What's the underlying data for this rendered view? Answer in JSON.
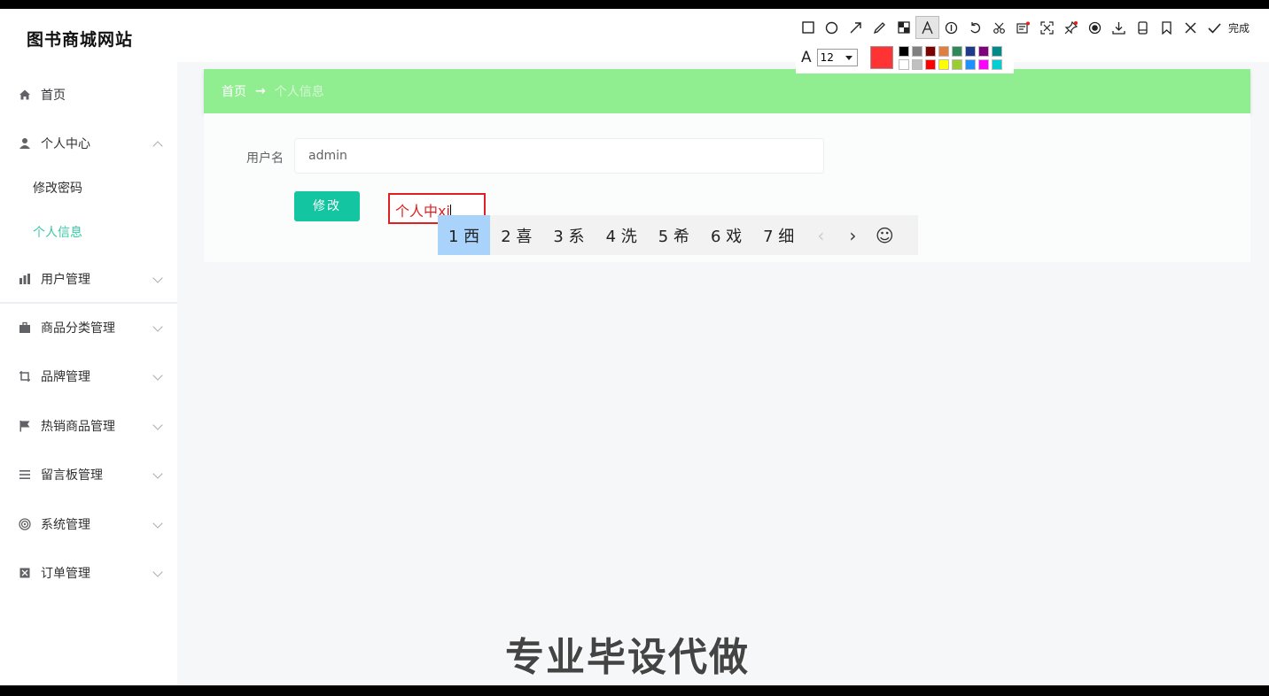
{
  "header": {
    "title": "图书商城网站",
    "links": [
      "",
      "",
      ""
    ]
  },
  "sidebar": {
    "items": [
      {
        "label": "首页",
        "icon": "home-icon"
      },
      {
        "label": "个人中心",
        "icon": "user-icon",
        "expanded": true,
        "children": [
          {
            "label": "修改密码"
          },
          {
            "label": "个人信息",
            "active": true
          }
        ]
      },
      {
        "label": "用户管理",
        "icon": "chart-icon"
      },
      {
        "label": "商品分类管理",
        "icon": "briefcase-icon"
      },
      {
        "label": "品牌管理",
        "icon": "crop-icon"
      },
      {
        "label": "热销商品管理",
        "icon": "flag-icon"
      },
      {
        "label": "留言板管理",
        "icon": "list-icon"
      },
      {
        "label": "系统管理",
        "icon": "target-icon"
      },
      {
        "label": "订单管理",
        "icon": "box-icon"
      }
    ]
  },
  "breadcrumb": {
    "home": "首页",
    "separator": "→",
    "current": "个人信息"
  },
  "form": {
    "username_label": "用户名",
    "username_value": "admin",
    "submit_label": "修改"
  },
  "annotation": {
    "text": "个人中xi"
  },
  "ime": {
    "candidates": [
      "1 西",
      "2 喜",
      "3 系",
      "4 洗",
      "5 希",
      "6 戏",
      "7 细"
    ],
    "prev": "‹",
    "next": "›",
    "emoji": "☺"
  },
  "snip_toolbar": {
    "tools": [
      "rectangle-icon",
      "ellipse-icon",
      "arrow-icon",
      "pen-icon",
      "mosaic-icon",
      "text-icon",
      "number-icon",
      "undo-icon",
      "cut-icon",
      "ocr-icon",
      "fullscreen-icon",
      "pin-icon",
      "record-icon",
      "download-icon",
      "save-icon",
      "bookmark-icon",
      "close-icon"
    ],
    "done_label": "完成",
    "font_size": "12",
    "current_color": "#ff3333",
    "palette": [
      "#000000",
      "#808080",
      "#800000",
      "#e08040",
      "#2e8b57",
      "#1e3a8a",
      "#800080",
      "#008b8b",
      "#ffffff",
      "#c0c0c0",
      "#ff0000",
      "#ffff00",
      "#9acd32",
      "#1e90ff",
      "#ff00ff",
      "#00ced1"
    ]
  },
  "watermark": {
    "text": "专业毕设代做"
  }
}
